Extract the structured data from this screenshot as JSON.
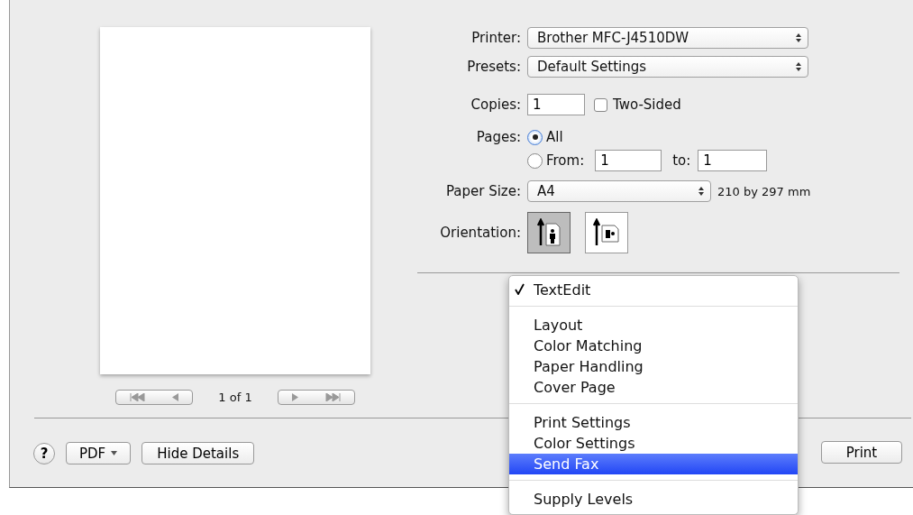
{
  "preview": {
    "page_counter": "1 of 1"
  },
  "printer": {
    "label": "Printer:",
    "value": "Brother MFC-J4510DW"
  },
  "presets": {
    "label": "Presets:",
    "value": "Default Settings"
  },
  "copies": {
    "label": "Copies:",
    "value": "1"
  },
  "two_sided": {
    "label": "Two-Sided",
    "checked": false
  },
  "pages": {
    "label": "Pages:",
    "options": [
      {
        "label": "All",
        "selected": true
      },
      {
        "label": "From:",
        "selected": false
      }
    ],
    "from": "1",
    "to_label": "to:",
    "to": "1"
  },
  "paper_size": {
    "label": "Paper Size:",
    "value": "A4",
    "dimensions": "210 by 297 mm"
  },
  "orientation": {
    "label": "Orientation:",
    "options": [
      {
        "kind": "portrait",
        "selected": true
      },
      {
        "kind": "landscape",
        "selected": false
      }
    ]
  },
  "menu": {
    "sections": [
      [
        {
          "label": "TextEdit",
          "checked": true,
          "selected": false
        }
      ],
      [
        {
          "label": "Layout",
          "checked": false,
          "selected": false
        },
        {
          "label": "Color Matching",
          "checked": false,
          "selected": false
        },
        {
          "label": "Paper Handling",
          "checked": false,
          "selected": false
        },
        {
          "label": "Cover Page",
          "checked": false,
          "selected": false
        }
      ],
      [
        {
          "label": "Print Settings",
          "checked": false,
          "selected": false
        },
        {
          "label": "Color Settings",
          "checked": false,
          "selected": false
        },
        {
          "label": "Send Fax",
          "checked": false,
          "selected": true
        }
      ],
      [
        {
          "label": "Supply Levels",
          "checked": false,
          "selected": false
        }
      ]
    ]
  },
  "buttons": {
    "help": "?",
    "pdf": "PDF",
    "hide_details": "Hide Details",
    "print": "Print"
  }
}
